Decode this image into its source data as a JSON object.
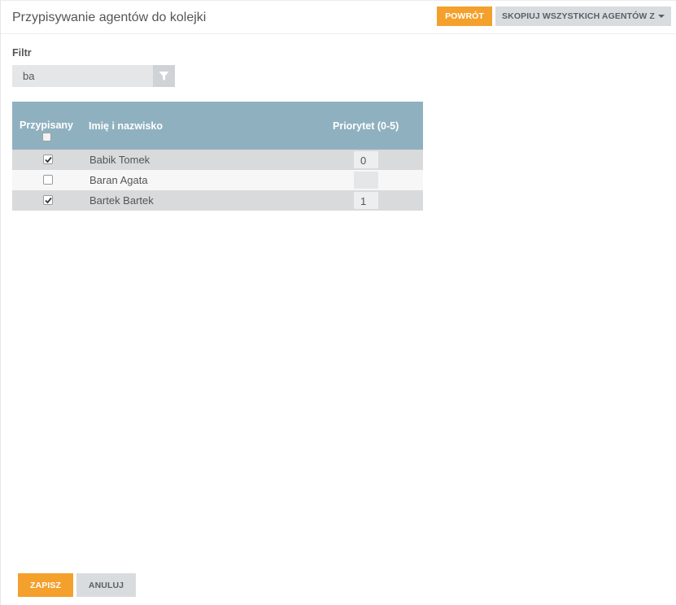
{
  "header": {
    "title": "Przypisywanie agentów do kolejki",
    "back_label": "POWRÓT",
    "copy_label": "SKOPIUJ WSZYSTKICH AGENTÓW Z"
  },
  "filter": {
    "label": "Filtr",
    "value": "ba",
    "icon": "filter-icon"
  },
  "table": {
    "columns": {
      "assigned": "Przypisany",
      "name": "Imię i nazwisko",
      "priority": "Priorytet (0-5)"
    },
    "header_checkbox_checked": false,
    "rows": [
      {
        "assigned": true,
        "name": "Babik Tomek",
        "priority": "0"
      },
      {
        "assigned": false,
        "name": "Baran Agata",
        "priority": ""
      },
      {
        "assigned": true,
        "name": "Bartek Bartek",
        "priority": "1"
      }
    ]
  },
  "footer": {
    "save_label": "ZAPISZ",
    "cancel_label": "ANULUJ"
  },
  "colors": {
    "accent_orange": "#f4a02c",
    "table_header": "#8fb0bf",
    "button_grey": "#d9dcdf"
  }
}
